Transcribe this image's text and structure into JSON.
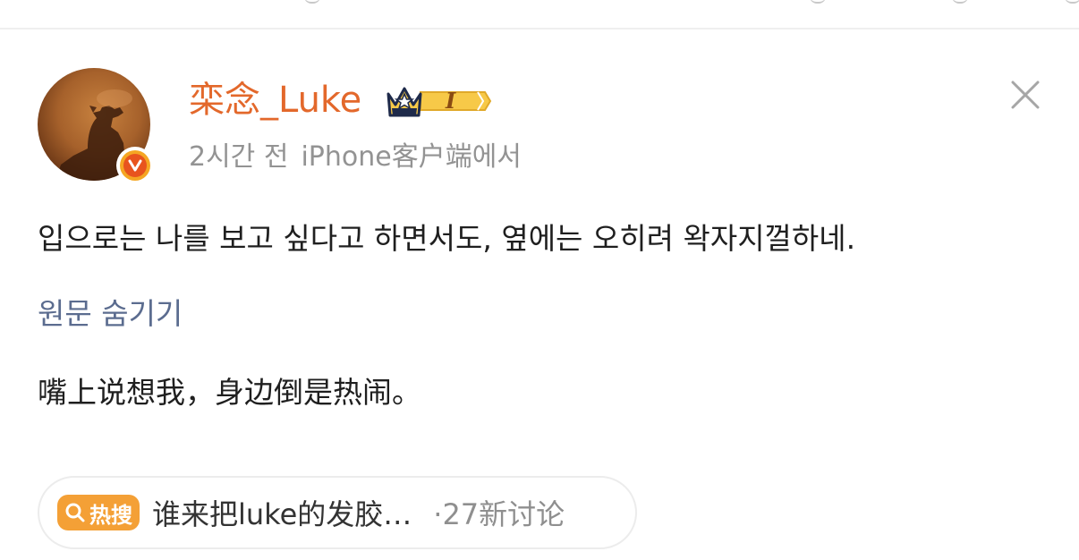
{
  "post": {
    "author": {
      "name": "栾念_Luke",
      "member_level": "I",
      "verified": true,
      "verified_mark": "v"
    },
    "meta": {
      "time": "2시간 전",
      "source": "iPhone客户端에서"
    },
    "text_translated": "입으로는 나를 보고 싶다고 하면서도, 옆에는 오히려 왁자지껄하네.",
    "toggle_label": "원문 숨기기",
    "text_original": "嘴上说想我，身边倒是热闹。"
  },
  "hot_topic": {
    "tag_label": "热搜",
    "title": "谁来把luke的发胶…",
    "count": "·27新讨论"
  },
  "colors": {
    "username": "#e3682b",
    "link": "#5b6c8f",
    "meta": "#939393",
    "hot_tag": "#f4a036",
    "verified": "#e8541e"
  },
  "icons": {
    "close": "close-icon",
    "crown": "crown-icon",
    "verified": "verified-icon",
    "search": "search-icon"
  }
}
